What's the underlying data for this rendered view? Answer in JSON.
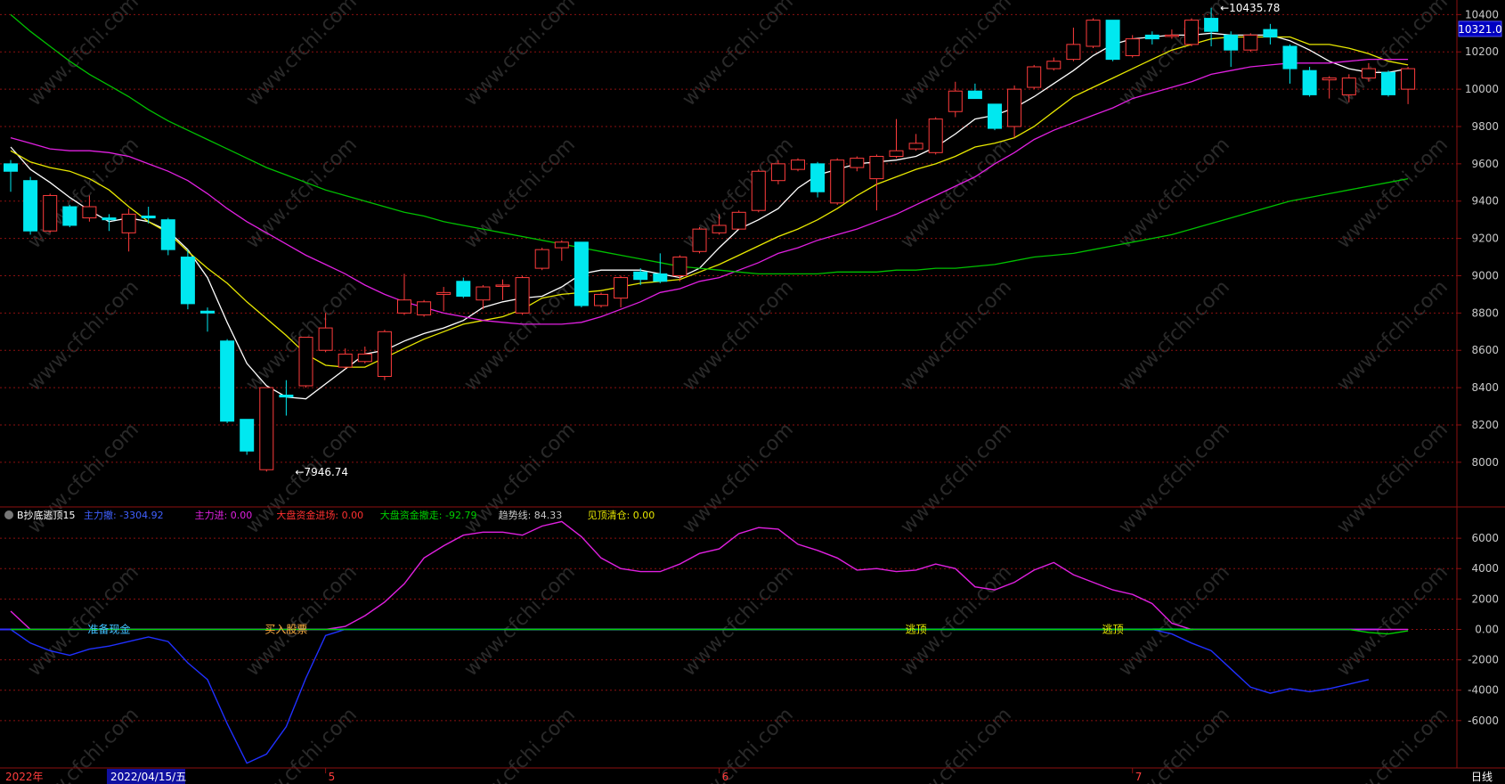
{
  "chart_data": [
    {
      "type": "candlestick",
      "y_ticks": [
        "10400",
        "10200",
        "10000",
        "9800",
        "9600",
        "9400",
        "9200",
        "9000",
        "8800",
        "8600",
        "8400",
        "8200",
        "8000"
      ],
      "y_tick_values": [
        10400,
        10200,
        10000,
        9800,
        9600,
        9400,
        9200,
        9000,
        8800,
        8600,
        8400,
        8200,
        8000
      ],
      "ylim": [
        7770,
        10440
      ],
      "current_price_label": "10321.0",
      "annotations": [
        {
          "text": "10435.78",
          "value": 10435.78,
          "bar": 61
        },
        {
          "text": "7946.74",
          "value": 7946.74,
          "bar": 14
        }
      ],
      "candles": [
        {
          "o": 9600,
          "c": 9560,
          "h": 9620,
          "l": 9450
        },
        {
          "o": 9510,
          "c": 9240,
          "h": 9530,
          "l": 9220
        },
        {
          "o": 9240,
          "c": 9430,
          "h": 9440,
          "l": 9230
        },
        {
          "o": 9370,
          "c": 9270,
          "h": 9380,
          "l": 9260
        },
        {
          "o": 9310,
          "c": 9370,
          "h": 9430,
          "l": 9290
        },
        {
          "o": 9310,
          "c": 9300,
          "h": 9330,
          "l": 9240
        },
        {
          "o": 9230,
          "c": 9330,
          "h": 9360,
          "l": 9130
        },
        {
          "o": 9320,
          "c": 9310,
          "h": 9370,
          "l": 9280
        },
        {
          "o": 9300,
          "c": 9140,
          "h": 9310,
          "l": 9110
        },
        {
          "o": 9100,
          "c": 8850,
          "h": 9140,
          "l": 8820
        },
        {
          "o": 8810,
          "c": 8800,
          "h": 8830,
          "l": 8700
        },
        {
          "o": 8650,
          "c": 8220,
          "h": 8660,
          "l": 8210
        },
        {
          "o": 8230,
          "c": 8060,
          "h": 8230,
          "l": 8040
        },
        {
          "o": 7960,
          "c": 8400,
          "h": 8400,
          "l": 7950
        },
        {
          "o": 8360,
          "c": 8350,
          "h": 8440,
          "l": 8250
        },
        {
          "o": 8410,
          "c": 8670,
          "h": 8670,
          "l": 8400
        },
        {
          "o": 8600,
          "c": 8720,
          "h": 8800,
          "l": 8590
        },
        {
          "o": 8510,
          "c": 8580,
          "h": 8610,
          "l": 8500
        },
        {
          "o": 8540,
          "c": 8580,
          "h": 8620,
          "l": 8530
        },
        {
          "o": 8460,
          "c": 8700,
          "h": 8710,
          "l": 8440
        },
        {
          "o": 8800,
          "c": 8870,
          "h": 9010,
          "l": 8790
        },
        {
          "o": 8790,
          "c": 8860,
          "h": 8870,
          "l": 8780
        },
        {
          "o": 8900,
          "c": 8910,
          "h": 8940,
          "l": 8810
        },
        {
          "o": 8970,
          "c": 8890,
          "h": 8990,
          "l": 8880
        },
        {
          "o": 8870,
          "c": 8940,
          "h": 8950,
          "l": 8820
        },
        {
          "o": 8950,
          "c": 8950,
          "h": 8980,
          "l": 8870
        },
        {
          "o": 8800,
          "c": 8990,
          "h": 9000,
          "l": 8790
        },
        {
          "o": 9040,
          "c": 9140,
          "h": 9150,
          "l": 9030
        },
        {
          "o": 9150,
          "c": 9180,
          "h": 9190,
          "l": 9080
        },
        {
          "o": 9180,
          "c": 8840,
          "h": 9180,
          "l": 8830
        },
        {
          "o": 8840,
          "c": 8900,
          "h": 8910,
          "l": 8830
        },
        {
          "o": 8880,
          "c": 8990,
          "h": 9000,
          "l": 8830
        },
        {
          "o": 9020,
          "c": 8980,
          "h": 9040,
          "l": 8950
        },
        {
          "o": 9010,
          "c": 8970,
          "h": 9120,
          "l": 8960
        },
        {
          "o": 9000,
          "c": 9100,
          "h": 9110,
          "l": 8970
        },
        {
          "o": 9130,
          "c": 9250,
          "h": 9260,
          "l": 9120
        },
        {
          "o": 9230,
          "c": 9270,
          "h": 9330,
          "l": 9220
        },
        {
          "o": 9250,
          "c": 9340,
          "h": 9350,
          "l": 9250
        },
        {
          "o": 9350,
          "c": 9560,
          "h": 9570,
          "l": 9340
        },
        {
          "o": 9510,
          "c": 9600,
          "h": 9620,
          "l": 9490
        },
        {
          "o": 9570,
          "c": 9620,
          "h": 9630,
          "l": 9560
        },
        {
          "o": 9600,
          "c": 9450,
          "h": 9610,
          "l": 9420
        },
        {
          "o": 9390,
          "c": 9620,
          "h": 9630,
          "l": 9380
        },
        {
          "o": 9580,
          "c": 9630,
          "h": 9640,
          "l": 9560
        },
        {
          "o": 9520,
          "c": 9640,
          "h": 9650,
          "l": 9350
        },
        {
          "o": 9640,
          "c": 9670,
          "h": 9840,
          "l": 9630
        },
        {
          "o": 9680,
          "c": 9710,
          "h": 9760,
          "l": 9670
        },
        {
          "o": 9660,
          "c": 9840,
          "h": 9850,
          "l": 9650
        },
        {
          "o": 9880,
          "c": 9990,
          "h": 10040,
          "l": 9850
        },
        {
          "o": 9990,
          "c": 9950,
          "h": 10030,
          "l": 9960
        },
        {
          "o": 9920,
          "c": 9790,
          "h": 9920,
          "l": 9780
        },
        {
          "o": 9800,
          "c": 10000,
          "h": 10020,
          "l": 9740
        },
        {
          "o": 10010,
          "c": 10120,
          "h": 10130,
          "l": 10000
        },
        {
          "o": 10110,
          "c": 10150,
          "h": 10170,
          "l": 10100
        },
        {
          "o": 10160,
          "c": 10240,
          "h": 10330,
          "l": 10150
        },
        {
          "o": 10230,
          "c": 10370,
          "h": 10380,
          "l": 10220
        },
        {
          "o": 10370,
          "c": 10160,
          "h": 10370,
          "l": 10150
        },
        {
          "o": 10180,
          "c": 10270,
          "h": 10290,
          "l": 10170
        },
        {
          "o": 10290,
          "c": 10270,
          "h": 10310,
          "l": 10240
        },
        {
          "o": 10290,
          "c": 10290,
          "h": 10320,
          "l": 10270
        },
        {
          "o": 10240,
          "c": 10370,
          "h": 10380,
          "l": 10230
        },
        {
          "o": 10380,
          "c": 10310,
          "h": 10435.78,
          "l": 10230
        },
        {
          "o": 10290,
          "c": 10210,
          "h": 10310,
          "l": 10120
        },
        {
          "o": 10210,
          "c": 10290,
          "h": 10300,
          "l": 10200
        },
        {
          "o": 10320,
          "c": 10280,
          "h": 10350,
          "l": 10240
        },
        {
          "o": 10230,
          "c": 10110,
          "h": 10240,
          "l": 10030
        },
        {
          "o": 10100,
          "c": 9970,
          "h": 10120,
          "l": 9960
        },
        {
          "o": 10050,
          "c": 10060,
          "h": 10070,
          "l": 9950
        },
        {
          "o": 9970,
          "c": 10060,
          "h": 10080,
          "l": 9930
        },
        {
          "o": 10060,
          "c": 10110,
          "h": 10140,
          "l": 10040
        },
        {
          "o": 10090,
          "c": 9970,
          "h": 10100,
          "l": 9960
        },
        {
          "o": 10000,
          "c": 10110,
          "h": 10120,
          "l": 9920
        }
      ],
      "ma_lines": [
        {
          "color": "#ffffff",
          "values": [
            9690,
            9570,
            9500,
            9420,
            9350,
            9290,
            9310,
            9290,
            9240,
            9140,
            8990,
            8750,
            8530,
            8410,
            8350,
            8340,
            8420,
            8500,
            8580,
            8600,
            8650,
            8690,
            8720,
            8760,
            8830,
            8860,
            8880,
            8890,
            8940,
            9010,
            9030,
            9030,
            9030,
            9010,
            8990,
            9040,
            9150,
            9250,
            9300,
            9360,
            9470,
            9540,
            9570,
            9600,
            9610,
            9620,
            9640,
            9690,
            9760,
            9840,
            9860,
            9900,
            9960,
            10030,
            10100,
            10180,
            10240,
            10270,
            10280,
            10290,
            10290,
            10300,
            10290,
            10290,
            10290,
            10260,
            10210,
            10150,
            10110,
            10090,
            10090,
            10110
          ]
        },
        {
          "color": "#e8e800",
          "values": [
            9670,
            9610,
            9580,
            9560,
            9520,
            9460,
            9370,
            9290,
            9230,
            9130,
            9040,
            8960,
            8860,
            8770,
            8680,
            8580,
            8520,
            8510,
            8510,
            8560,
            8610,
            8660,
            8700,
            8740,
            8760,
            8780,
            8820,
            8880,
            8900,
            8910,
            8920,
            8940,
            8960,
            8970,
            8980,
            9020,
            9060,
            9110,
            9160,
            9210,
            9250,
            9300,
            9360,
            9430,
            9490,
            9530,
            9570,
            9600,
            9640,
            9690,
            9710,
            9740,
            9800,
            9880,
            9960,
            10010,
            10060,
            10110,
            10160,
            10210,
            10240,
            10270,
            10280,
            10280,
            10280,
            10280,
            10240,
            10240,
            10220,
            10190,
            10150,
            10130
          ]
        },
        {
          "color": "#e020e0",
          "values": [
            9740,
            9710,
            9680,
            9670,
            9670,
            9660,
            9640,
            9600,
            9560,
            9510,
            9440,
            9360,
            9290,
            9230,
            9170,
            9110,
            9060,
            9010,
            8950,
            8900,
            8860,
            8830,
            8800,
            8780,
            8760,
            8750,
            8740,
            8740,
            8740,
            8750,
            8780,
            8820,
            8860,
            8910,
            8930,
            8970,
            8990,
            9030,
            9070,
            9120,
            9150,
            9190,
            9220,
            9250,
            9290,
            9330,
            9380,
            9430,
            9480,
            9530,
            9600,
            9660,
            9730,
            9780,
            9820,
            9860,
            9900,
            9950,
            9980,
            10010,
            10040,
            10080,
            10100,
            10120,
            10130,
            10140,
            10140,
            10140,
            10150,
            10160,
            10160,
            10160
          ]
        },
        {
          "color": "#00c000",
          "values": [
            10400,
            10310,
            10230,
            10150,
            10080,
            10020,
            9960,
            9890,
            9830,
            9780,
            9730,
            9680,
            9630,
            9580,
            9540,
            9500,
            9460,
            9430,
            9400,
            9370,
            9340,
            9320,
            9290,
            9270,
            9250,
            9230,
            9210,
            9190,
            9170,
            9150,
            9130,
            9110,
            9090,
            9070,
            9050,
            9040,
            9030,
            9020,
            9010,
            9010,
            9010,
            9010,
            9020,
            9020,
            9020,
            9030,
            9030,
            9040,
            9040,
            9050,
            9060,
            9080,
            9100,
            9110,
            9120,
            9140,
            9160,
            9180,
            9200,
            9220,
            9250,
            9280,
            9310,
            9340,
            9370,
            9400,
            9420,
            9440,
            9460,
            9480,
            9500,
            9520
          ]
        }
      ]
    },
    {
      "type": "line",
      "indicator_title": "B抄底逃顶15",
      "legend": [
        {
          "label": "主力撤: -3304.92",
          "color": "#4060ff"
        },
        {
          "label": "主力进: 0.00",
          "color": "#e020e0"
        },
        {
          "label": "大盘资金进场: 0.00",
          "color": "#ff3030"
        },
        {
          "label": "大盘资金撤走: -92.79",
          "color": "#00d000"
        },
        {
          "label": "趋势线: 84.33",
          "color": "#c8c8c8"
        },
        {
          "label": "见顶清仓: 0.00",
          "color": "#e8e800"
        }
      ],
      "y_ticks": [
        "6000",
        "4000",
        "2000",
        "0.00",
        "-2000",
        "-4000",
        "-6000"
      ],
      "y_tick_values": [
        6000,
        4000,
        2000,
        0,
        -2000,
        -4000,
        -6000
      ],
      "ylim": [
        -9000,
        8000
      ],
      "labels": [
        {
          "text": "准备现金",
          "bar": 5,
          "color": "#40c0ff"
        },
        {
          "text": "买入股票",
          "bar": 14,
          "color": "#ffb040"
        },
        {
          "text": "逃顶",
          "bar": 46,
          "color": "#e8e800"
        },
        {
          "text": "逃顶",
          "bar": 56,
          "color": "#e8e800"
        }
      ],
      "series": [
        {
          "color": "#e020e0",
          "values": [
            1200,
            0,
            0,
            0,
            0,
            0,
            0,
            0,
            0,
            0,
            0,
            0,
            0,
            0,
            0,
            0,
            0,
            200,
            900,
            1800,
            3000,
            4700,
            5500,
            6200,
            6400,
            6400,
            6200,
            6800,
            7100,
            6100,
            4700,
            4000,
            3800,
            3800,
            4300,
            5000,
            5300,
            6300,
            6700,
            6600,
            5600,
            5200,
            4700,
            3900,
            4000,
            3800,
            3900,
            4300,
            4000,
            2800,
            2600,
            3100,
            3900,
            4400,
            3600,
            3100,
            2600,
            2300,
            1700,
            400,
            0,
            0,
            0,
            0,
            0,
            0,
            0,
            0,
            0,
            0,
            0,
            0
          ]
        },
        {
          "color": "#2030ff",
          "values": [
            0,
            -900,
            -1400,
            -1700,
            -1300,
            -1100,
            -800,
            -500,
            -800,
            -2200,
            -3300,
            -6200,
            -8800,
            -8200,
            -6400,
            -3200,
            -400,
            0,
            0,
            0,
            0,
            0,
            0,
            0,
            0,
            0,
            0,
            0,
            0,
            0,
            0,
            0,
            0,
            0,
            0,
            0,
            0,
            0,
            0,
            0,
            0,
            0,
            0,
            0,
            0,
            0,
            0,
            0,
            0,
            0,
            0,
            0,
            0,
            0,
            0,
            0,
            0,
            0,
            0,
            -300,
            -900,
            -1400,
            -2600,
            -3800,
            -4200,
            -3900,
            -4100,
            -3900,
            -3600,
            -3300
          ]
        },
        {
          "color": "#00d000",
          "values": [
            0,
            0,
            0,
            0,
            0,
            0,
            0,
            0,
            0,
            0,
            0,
            0,
            0,
            0,
            0,
            0,
            0,
            0,
            0,
            0,
            0,
            0,
            0,
            0,
            0,
            0,
            0,
            0,
            0,
            0,
            0,
            0,
            0,
            0,
            0,
            0,
            0,
            0,
            0,
            0,
            0,
            0,
            0,
            0,
            0,
            0,
            0,
            0,
            0,
            0,
            0,
            0,
            0,
            0,
            0,
            0,
            0,
            0,
            0,
            0,
            0,
            0,
            0,
            0,
            0,
            0,
            0,
            0,
            0,
            -200,
            -300,
            -93
          ]
        }
      ]
    }
  ],
  "x_axis": {
    "start": "2022年",
    "selected_date": "2022/04/15/五",
    "months": [
      {
        "text": "5",
        "bar": 16
      },
      {
        "text": "6",
        "bar": 36
      },
      {
        "text": "7",
        "bar": 57
      }
    ],
    "period_label": "日线"
  },
  "watermark": "www.cfchi.com",
  "colors": {
    "up": "#ff3c3c",
    "down": "#00e8f0",
    "grid": "#8b1010",
    "axis_text": "#c8c8c8",
    "selected_bg": "#1010a0"
  }
}
